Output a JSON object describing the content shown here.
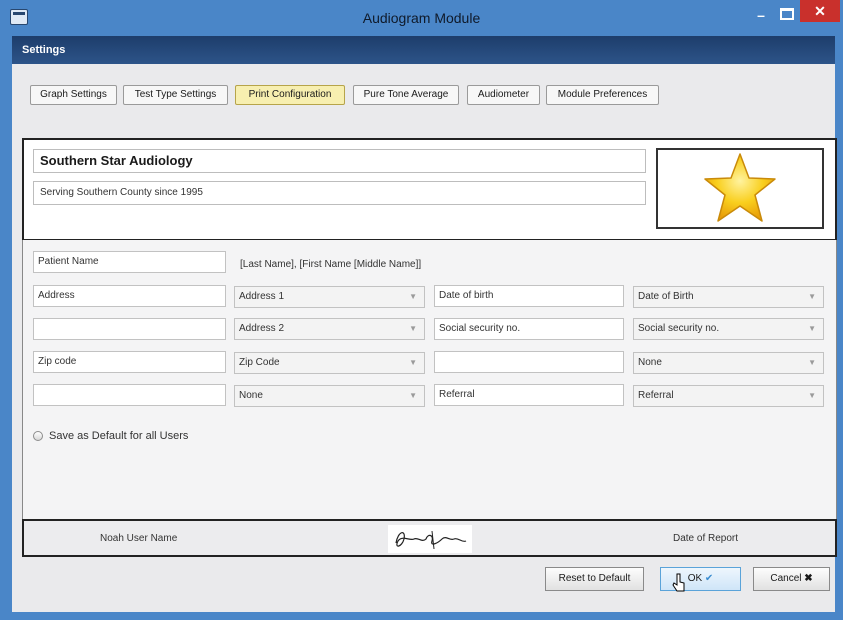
{
  "window": {
    "title": "Audiogram Module",
    "minimize_glyph": "–",
    "close_glyph": "✕"
  },
  "settings": {
    "header": "Settings"
  },
  "tabs": [
    {
      "label": "Graph Settings"
    },
    {
      "label": "Test Type Settings"
    },
    {
      "label": "Print Configuration",
      "active": true
    },
    {
      "label": "Pure Tone Average"
    },
    {
      "label": "Audiometer"
    },
    {
      "label": "Module Preferences"
    }
  ],
  "header_box": {
    "practice_name": "Southern Star Audiology",
    "practice_subtitle": "Serving Southern County since 1995",
    "logo_icon": "star-icon",
    "logo_color": "#f7c61a"
  },
  "patient": {
    "label_field": "Patient Name",
    "format_text": "[Last Name], [First Name [Middle Name]]"
  },
  "rows": [
    {
      "left_field": "Address",
      "left_select": "Address 1",
      "right_field": "Date of birth",
      "right_select": "Date of Birth"
    },
    {
      "left_field": "",
      "left_select": "Address 2",
      "right_field": "Social security no.",
      "right_select": "Social security no."
    },
    {
      "left_field": "Zip code",
      "left_select": "Zip Code",
      "right_field": "",
      "right_select": "None"
    },
    {
      "left_field": "",
      "left_select": "None",
      "right_field": "Referral",
      "right_select": "Referral"
    }
  ],
  "default_checkbox": {
    "label": "Save as Default for all Users"
  },
  "footer": {
    "user_name": "Noah User Name",
    "date_label": "Date of Report"
  },
  "buttons": {
    "reset": "Reset to Default",
    "ok": "OK",
    "cancel": "Cancel"
  }
}
